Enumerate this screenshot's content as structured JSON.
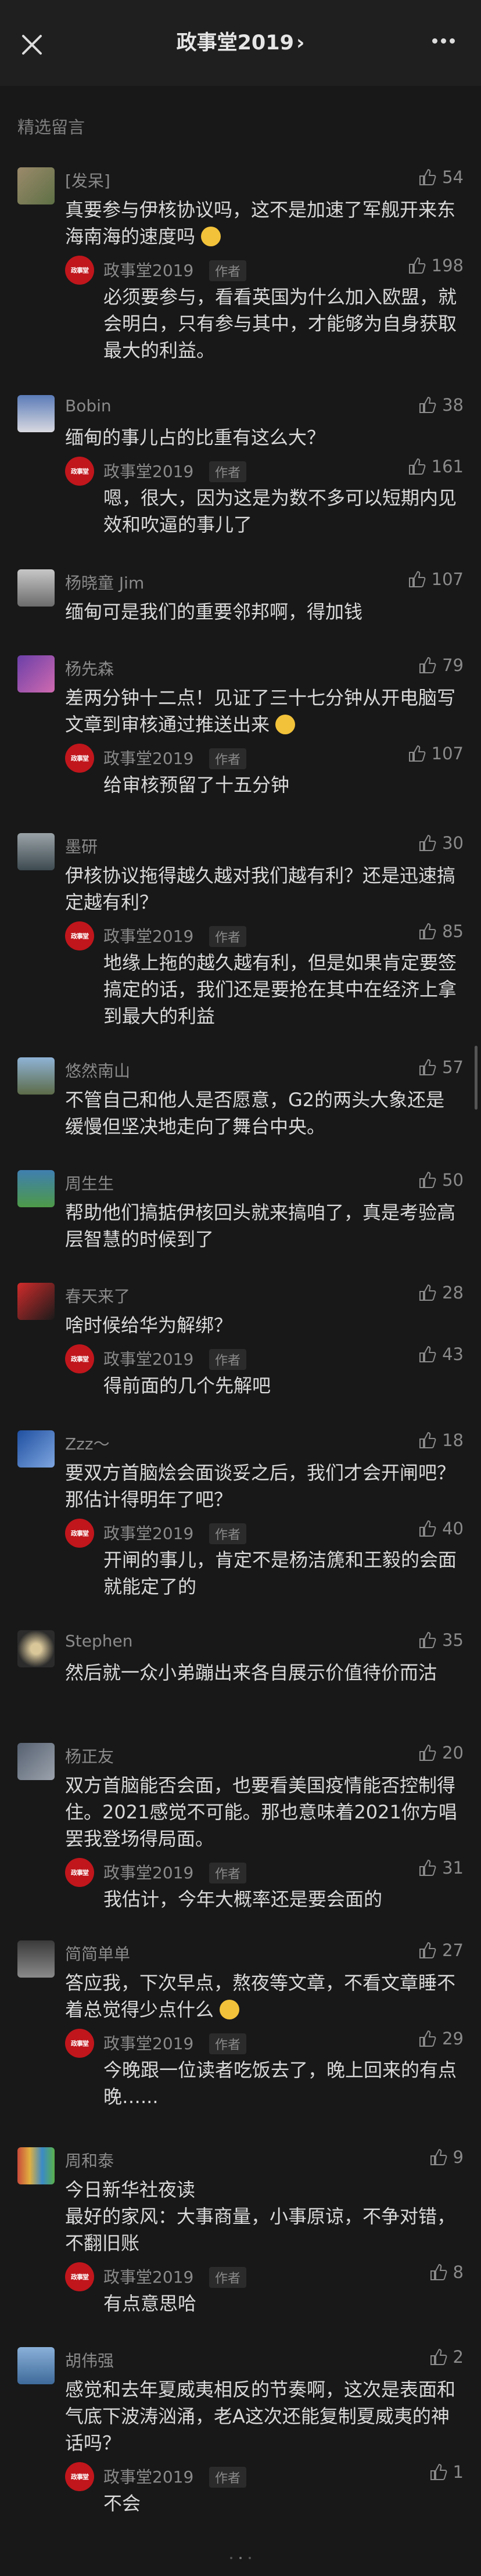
{
  "nav": {
    "title": "政事堂2019",
    "chevron": "›"
  },
  "section_title": "精选留言",
  "reply_author": "政事堂2019",
  "author_tag": "作者",
  "comments": [
    {
      "name": "[发呆]",
      "likes": "54",
      "text": "真要参与伊核协议吗，这不是加速了军舰开来东海南海的速度吗",
      "reply": {
        "likes": "198",
        "text": "必须要参与，看看英国为什么加入欧盟，就会明白，只有参与其中，才能够为自身获取最大的利益。"
      }
    },
    {
      "name": "Bobin",
      "likes": "38",
      "text": "缅甸的事儿占的比重有这么大？",
      "reply": {
        "likes": "161",
        "text": "嗯，很大，因为这是为数不多可以短期内见效和吹逼的事儿了"
      }
    },
    {
      "name": "杨晓童 Jim",
      "likes": "107",
      "text": "缅甸可是我们的重要邻邦啊，得加钱"
    },
    {
      "name": "杨先森",
      "likes": "79",
      "text": "差两分钟十二点！见证了三十七分钟从开电脑写文章到审核通过推送出来",
      "reply": {
        "likes": "107",
        "text": "给审核预留了十五分钟"
      }
    },
    {
      "name": "墨研",
      "likes": "30",
      "text": "伊核协议拖得越久越对我们越有利？还是迅速搞定越有利？",
      "reply": {
        "likes": "85",
        "text": "地缘上拖的越久越有利，但是如果肯定要签搞定的话，我们还是要抢在其中在经济上拿到最大的利益"
      }
    },
    {
      "name": "悠然南山",
      "likes": "57",
      "text": "不管自己和他人是否愿意，G2的两头大象还是缓慢但坚决地走向了舞台中央。"
    },
    {
      "name": "周生生",
      "likes": "50",
      "text": "帮助他们搞掂伊核回头就来搞咱了，真是考验高层智慧的时候到了"
    },
    {
      "name": "春天来了",
      "likes": "28",
      "text": "啥时候给华为解绑？",
      "reply": {
        "likes": "43",
        "text": "得前面的几个先解吧"
      }
    },
    {
      "name": "Zzz～",
      "likes": "18",
      "text": "要双方首脑烩会面谈妥之后，我们才会开闸吧？那估计得明年了吧？",
      "reply": {
        "likes": "40",
        "text": "开闸的事儿，肯定不是杨洁篪和王毅的会面就能定了的"
      }
    },
    {
      "name": "Stephen",
      "likes": "35",
      "text": "然后就一众小弟蹦出来各自展示价值待价而沽"
    },
    {
      "name": "杨正友",
      "likes": "20",
      "text": "双方首脑能否会面，也要看美国疫情能否控制得住。2021感觉不可能。那也意味着2021你方唱罢我登场得局面。",
      "reply": {
        "likes": "31",
        "text": "我估计，今年大概率还是要会面的"
      }
    },
    {
      "name": "简简单单",
      "likes": "27",
      "text": "答应我，下次早点，熬夜等文章，不看文章睡不着总觉得少点什么",
      "reply": {
        "likes": "29",
        "text": "今晚跟一位读者吃饭去了，晚上回来的有点晚…..."
      }
    },
    {
      "name": "周和泰",
      "likes": "9",
      "text": "今日新华社夜读\n最好的家风：大事商量，小事原谅，不争对错，不翻旧账",
      "reply": {
        "likes": "8",
        "text": "有点意思哈"
      }
    },
    {
      "name": "胡伟强",
      "likes": "2",
      "text": "感觉和去年夏威夷相反的节奏啊，这次是表面和气底下波涛汹涌，老A这次还能复制夏威夷的神话吗？",
      "reply": {
        "likes": "1",
        "text": "不会"
      }
    }
  ],
  "colors": {
    "background": "#181818",
    "text": "#d9d9d9",
    "secondary": "#8a8a8a",
    "brand_red": "#c0161c"
  },
  "icons": {
    "close": "close-icon",
    "more": "more-icon",
    "like": "thumbs-up-icon"
  }
}
